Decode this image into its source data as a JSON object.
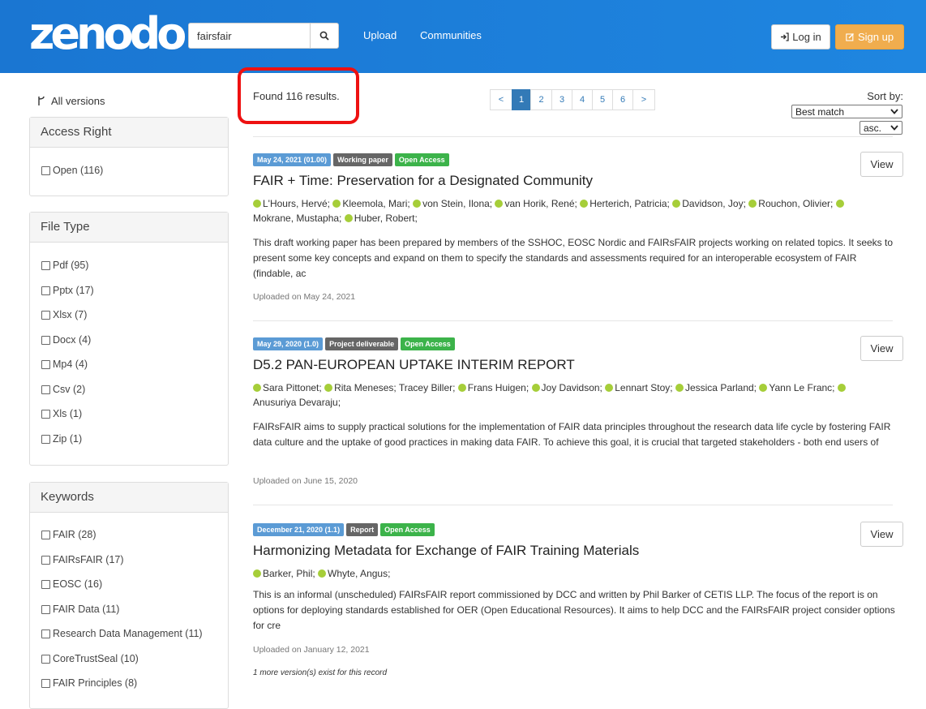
{
  "header": {
    "logo": "zenodo",
    "search_value": "fairsfair",
    "nav": [
      "Upload",
      "Communities"
    ],
    "login_label": "Log in",
    "signup_label": "Sign up"
  },
  "sidebar": {
    "all_versions": "All versions",
    "access_right": {
      "title": "Access Right",
      "items": [
        "Open (116)"
      ]
    },
    "file_type": {
      "title": "File Type",
      "items": [
        "Pdf (95)",
        "Pptx (17)",
        "Xlsx (7)",
        "Docx (4)",
        "Mp4 (4)",
        "Csv (2)",
        "Xls (1)",
        "Zip (1)"
      ]
    },
    "keywords": {
      "title": "Keywords",
      "items": [
        "FAIR (28)",
        "FAIRsFAIR (17)",
        "EOSC (16)",
        "FAIR Data (11)",
        "Research Data Management (11)",
        "CoreTrustSeal (10)",
        "FAIR Principles (8)"
      ]
    }
  },
  "results": {
    "found_text": "Found 116 results.",
    "pagination": [
      "<",
      "1",
      "2",
      "3",
      "4",
      "5",
      "6",
      ">"
    ],
    "active_page": "1",
    "sort_label": "Sort by:",
    "sort_value": "Best match",
    "order_value": "asc.",
    "view_label": "View",
    "records": [
      {
        "date": "May 24, 2021 (01.00)",
        "type": "Working paper",
        "access": "Open Access",
        "title": "FAIR + Time: Preservation for a Designated Community",
        "authors_line1": [
          "L'Hours, Hervé;",
          "Kleemola, Mari;",
          "von Stein, Ilona;",
          "van Horik, René;",
          "Herterich, Patricia;",
          "Davidson, Joy;",
          "Rouchon, Olivier;"
        ],
        "authors_line2": [
          "Mokrane, Mustapha;",
          "Huber, Robert;"
        ],
        "description": "This draft working paper has been prepared by members of the SSHOC, EOSC Nordic and FAIRsFAIR  projects working on related topics. It seeks to present some key concepts and expand on them to specify the standards and assessments required for an interoperable ecosystem of FAIR (findable, ac",
        "uploaded": "Uploaded on May 24, 2021"
      },
      {
        "date": "May 29, 2020 (1.0)",
        "type": "Project deliverable",
        "access": "Open Access",
        "title": "D5.2 PAN-EUROPEAN UPTAKE INTERIM REPORT",
        "authors_line1": [
          "Sara Pittonet;",
          "Rita Meneses; Tracey Biller;",
          "Frans Huigen;",
          "Joy Davidson;",
          "Lennart Stoy;",
          "Jessica Parland;",
          "Yann Le Franc;"
        ],
        "authors_line2": [
          "Anusuriya Devaraju;"
        ],
        "description": "FAIRsFAIR aims to supply practical solutions for the implementation of FAIR data principles throughout the research data life cycle by fostering FAIR data culture and the uptake of good practices in making data FAIR. To achieve this goal, it is crucial that targeted stakeholders - both end users of",
        "uploaded": "Uploaded on June 15, 2020"
      },
      {
        "date": "December 21, 2020 (1.1)",
        "type": "Report",
        "access": "Open Access",
        "title": "Harmonizing Metadata for Exchange of FAIR Training Materials",
        "authors_line1": [
          "Barker, Phil;",
          "Whyte, Angus;"
        ],
        "authors_line2": [],
        "description": "This is an informal (unscheduled) FAIRsFAIR report commissioned by DCC and written by Phil Barker of CETIS LLP. The focus of the report is on options for deploying standards established for OER (Open Educational Resources).  It aims to help DCC and the FAIRsFAIR project consider options for cre",
        "uploaded": "Uploaded on January 12, 2021",
        "more_versions": "1 more version(s) exist for this record"
      }
    ]
  }
}
